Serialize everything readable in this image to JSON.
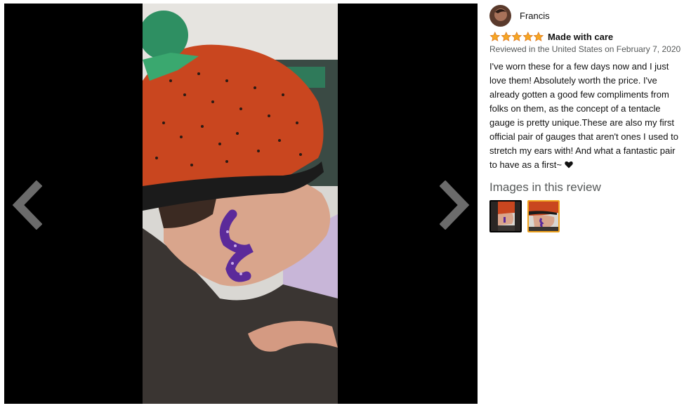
{
  "reviewer": {
    "name": "Francis"
  },
  "review": {
    "rating": 5,
    "rating_max": 5,
    "title": "Made with care",
    "meta": "Reviewed in the United States on February 7, 2020",
    "body": "I've worn these for a few days now and I just love them! Absolutely worth the price. I've already gotten a good few compliments from folks on them, as the concept of a tentacle gauge is pretty unique.These are also my first official pair of gauges that aren't ones I used to stretch my ears with! And what a fantastic pair to have as a first~ "
  },
  "images_section": {
    "heading": "Images in this review",
    "thumbnails": [
      {
        "icon": "photo-thumbnail",
        "selected": false
      },
      {
        "icon": "photo-thumbnail",
        "selected": true
      }
    ]
  },
  "viewer": {
    "prev_icon": "chevron-left-icon",
    "next_icon": "chevron-right-icon"
  },
  "colors": {
    "star": "#f5a623",
    "star_outline": "#de7921",
    "selected_border": "#f0a31e",
    "viewer_bg": "#000000",
    "meta_text": "#565959"
  }
}
